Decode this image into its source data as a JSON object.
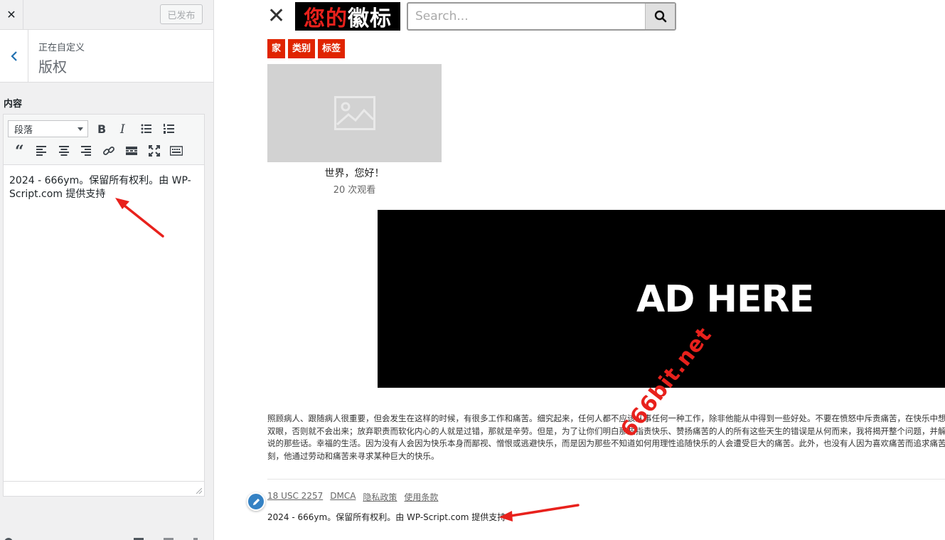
{
  "customizer": {
    "close_icon": "close-icon",
    "publish_label": "已发布",
    "back_icon": "chevron-left-icon",
    "customizing_label": "正在自定义",
    "section_title": "版权",
    "content_label": "内容",
    "editor": {
      "format_select_value": "段落",
      "toolbar_icons": [
        "bold-icon",
        "italic-icon",
        "bullet-list-icon",
        "numbered-list-icon",
        "blockquote-icon",
        "align-left-icon",
        "align-center-icon",
        "align-right-icon",
        "link-icon",
        "read-more-icon",
        "fullscreen-icon",
        "toolbar-toggle-icon"
      ],
      "text": "2024 - 666ym。保留所有权利。由 WP-Script.com 提供支持"
    }
  },
  "preview": {
    "close_icon": "close-icon",
    "logo": {
      "part1": "您的",
      "part2": "徽标"
    },
    "search": {
      "placeholder": "Search...",
      "button_icon": "search-icon"
    },
    "nav": [
      "家",
      "类别",
      "标签"
    ],
    "post": {
      "title": "世界，您好！",
      "views_count": "20",
      "views_label": "次观看",
      "thumb_icon": "image-placeholder-icon"
    },
    "ad_text": "AD HERE",
    "description_lines": [
      "照顾病人、跟随病人很重要，但会发生在这样的时候，有很多工作和痛苦。细究起来，任何人都不应该从事任何一种工作，除非他能从中得到一些好处。不要在愤怒中斥责痛苦，在快乐中想",
      "双眼，否则就不会出来；放弃职责而软化内心的人就是过错，那就是辛劳。但是，为了让你们明白那些指责快乐、赞扬痛苦的人的所有这些天生的错误是从何而来，我将揭开整个问题，并解释",
      "说的那些话。幸福的生活。因为没有人会因为快乐本身而鄙视、憎恨或逃避快乐，而是因为那些不知道如何用理性追随快乐的人会遭受巨大的痛苦。此外，也没有人因为喜欢痛苦而追求痛苦",
      "刻，他通过劳动和痛苦来寻求某种巨大的快乐。"
    ],
    "footer_links": [
      "18 USC 2257",
      "DMCA",
      "隐私政策",
      "使用条款"
    ],
    "copyright": "2024 - 666ym。保留所有权利。由 WP-Script.com 提供支持",
    "edit_shortcut_icon": "pencil-icon"
  },
  "watermark": "666bit.net",
  "colors": {
    "accent_red": "#e02400",
    "wp_blue": "#3582c4",
    "annotation_red": "#e8211c"
  }
}
